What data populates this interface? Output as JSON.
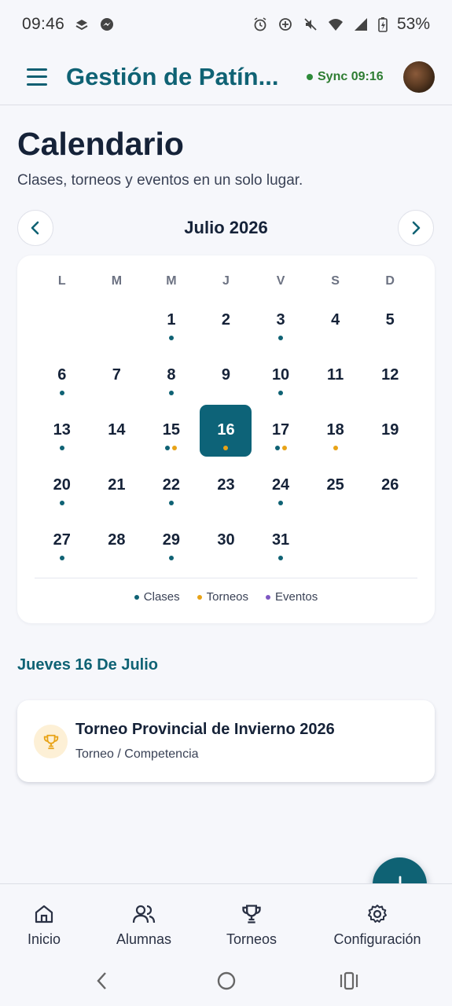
{
  "status_bar": {
    "time": "09:46",
    "battery": "53%",
    "icons": [
      "stack-icon",
      "messenger-icon",
      "alarm-icon",
      "data-saver-icon",
      "mute-icon",
      "wifi-icon",
      "signal-icon",
      "battery-icon"
    ]
  },
  "app_bar": {
    "title": "Gestión de Patín...",
    "sync_label": "Sync 09:16",
    "menu_icon": "hamburger-menu-icon"
  },
  "page": {
    "title": "Calendario",
    "subtitle": "Clases, torneos y eventos en un solo lugar."
  },
  "calendar": {
    "month_label": "Julio 2026",
    "weekdays": [
      "L",
      "M",
      "M",
      "J",
      "V",
      "S",
      "D"
    ],
    "leading_blanks": 2,
    "selected_day": 16,
    "days": [
      {
        "n": "1",
        "events": [
          "clases"
        ]
      },
      {
        "n": "2",
        "events": []
      },
      {
        "n": "3",
        "events": [
          "clases"
        ]
      },
      {
        "n": "4",
        "events": []
      },
      {
        "n": "5",
        "events": []
      },
      {
        "n": "6",
        "events": [
          "clases"
        ]
      },
      {
        "n": "7",
        "events": []
      },
      {
        "n": "8",
        "events": [
          "clases"
        ]
      },
      {
        "n": "9",
        "events": []
      },
      {
        "n": "10",
        "events": [
          "clases"
        ]
      },
      {
        "n": "11",
        "events": []
      },
      {
        "n": "12",
        "events": []
      },
      {
        "n": "13",
        "events": [
          "clases"
        ]
      },
      {
        "n": "14",
        "events": []
      },
      {
        "n": "15",
        "events": [
          "clases",
          "torneos"
        ]
      },
      {
        "n": "16",
        "events": [
          "torneos"
        ]
      },
      {
        "n": "17",
        "events": [
          "clases",
          "torneos"
        ]
      },
      {
        "n": "18",
        "events": [
          "torneos"
        ]
      },
      {
        "n": "19",
        "events": []
      },
      {
        "n": "20",
        "events": [
          "clases"
        ]
      },
      {
        "n": "21",
        "events": []
      },
      {
        "n": "22",
        "events": [
          "clases"
        ]
      },
      {
        "n": "23",
        "events": []
      },
      {
        "n": "24",
        "events": [
          "clases"
        ]
      },
      {
        "n": "25",
        "events": []
      },
      {
        "n": "26",
        "events": []
      },
      {
        "n": "27",
        "events": [
          "clases"
        ]
      },
      {
        "n": "28",
        "events": []
      },
      {
        "n": "29",
        "events": [
          "clases"
        ]
      },
      {
        "n": "30",
        "events": []
      },
      {
        "n": "31",
        "events": [
          "clases"
        ]
      }
    ],
    "legend": [
      {
        "key": "clases",
        "label": "Clases",
        "color": "#0f6274"
      },
      {
        "key": "torneos",
        "label": "Torneos",
        "color": "#e8a317"
      },
      {
        "key": "eventos",
        "label": "Eventos",
        "color": "#7e57c2"
      }
    ]
  },
  "selected_date": {
    "heading": "Jueves 16 De Julio",
    "events": [
      {
        "title": "Torneo Provincial de Invierno 2026",
        "subtitle": "Torneo / Competencia",
        "icon": "trophy-icon"
      }
    ]
  },
  "bottom_nav": {
    "tabs": [
      {
        "label": "Inicio",
        "icon": "home-icon"
      },
      {
        "label": "Alumnas",
        "icon": "users-icon"
      },
      {
        "label": "Torneos",
        "icon": "trophy-icon"
      },
      {
        "label": "Configuración",
        "icon": "gear-icon"
      }
    ]
  },
  "fab": {
    "icon": "plus-icon"
  },
  "colors": {
    "primary": "#0f6274",
    "selected_day_bg": "#0d6378",
    "sync_green": "#2e7d32",
    "background": "#f6f7fb"
  }
}
